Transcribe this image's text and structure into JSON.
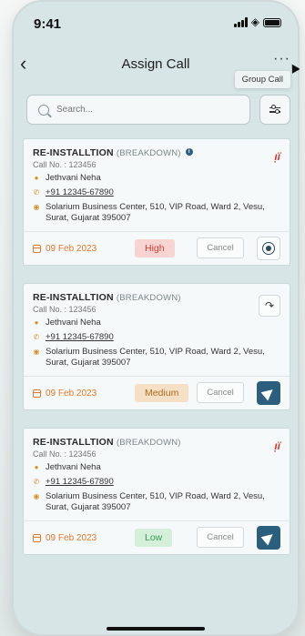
{
  "status": {
    "time": "9:41"
  },
  "header": {
    "title": "Assign Call",
    "back_icon": "chevron-left-icon",
    "more_icon": "more-horizontal-icon"
  },
  "tooltip": {
    "label": "Group Call"
  },
  "search": {
    "placeholder": "Search..."
  },
  "cards": [
    {
      "title": "RE-INSTALLTION",
      "type": "(BREAKDOWN)",
      "call_no": "Call No. : 123456",
      "name": "Jethvani Neha",
      "phone": "+91 12345-67890",
      "address": "Solarium Business Center, 510, VIP Road, Ward 2, Vesu, Surat, Gujarat 395007",
      "date": "09 Feb 2023",
      "priority": "High",
      "cancel_label": "Cancel",
      "top_icon": "assign-engineer-icon",
      "action_icon": "locate-icon"
    },
    {
      "title": "RE-INSTALLTION",
      "type": "(BREAKDOWN)",
      "call_no": "Call No. : 123456",
      "name": "Jethvani Neha",
      "phone": "+91 12345-67890",
      "address": "Solarium Business Center, 510, VIP Road, Ward 2, Vesu, Surat, Gujarat 395007",
      "date": "09 Feb 2023",
      "priority": "Medium",
      "cancel_label": "Cancel",
      "top_icon": "forward-icon",
      "action_icon": "send-icon"
    },
    {
      "title": "RE-INSTALLTION",
      "type": "(BREAKDOWN)",
      "call_no": "Call No. : 123456",
      "name": "Jethvani Neha",
      "phone": "+91 12345-67890",
      "address": "Solarium Business Center, 510, VIP Road, Ward 2, Vesu, Surat, Gujarat 395007",
      "date": "09 Feb 2023",
      "priority": "Low",
      "cancel_label": "Cancel",
      "top_icon": "assign-engineer-icon",
      "action_icon": "send-icon"
    }
  ],
  "colors": {
    "accent": "#2c5f7d",
    "date": "#e07a2e",
    "high": "#cc3f37",
    "medium": "#b26b1e",
    "low": "#3b9a52"
  }
}
